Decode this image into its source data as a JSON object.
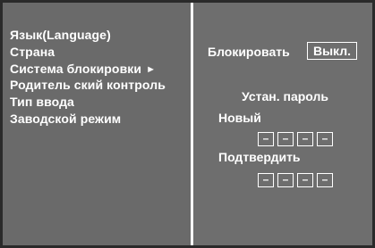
{
  "menu": {
    "items": [
      {
        "label": "Язык(Language)"
      },
      {
        "label": "Страна"
      },
      {
        "label": "Система блокировки",
        "selected": true,
        "arrow": "►"
      },
      {
        "label": "Родитель ский контроль"
      },
      {
        "label": "Тип ввода"
      },
      {
        "label": "Заводской режим"
      }
    ]
  },
  "lock_panel": {
    "lock_label": "Блокировать",
    "lock_value": "Выкл.",
    "set_password_label": "Устан. пароль",
    "new_label": "Новый",
    "new_digits": [
      "–",
      "–",
      "–",
      "–"
    ],
    "confirm_label": "Подтвердить",
    "confirm_digits": [
      "–",
      "–",
      "–",
      "–"
    ]
  },
  "colors": {
    "panel_background": "#6a6a6a",
    "text": "#ffffff",
    "frame": "#2a2a2a"
  }
}
